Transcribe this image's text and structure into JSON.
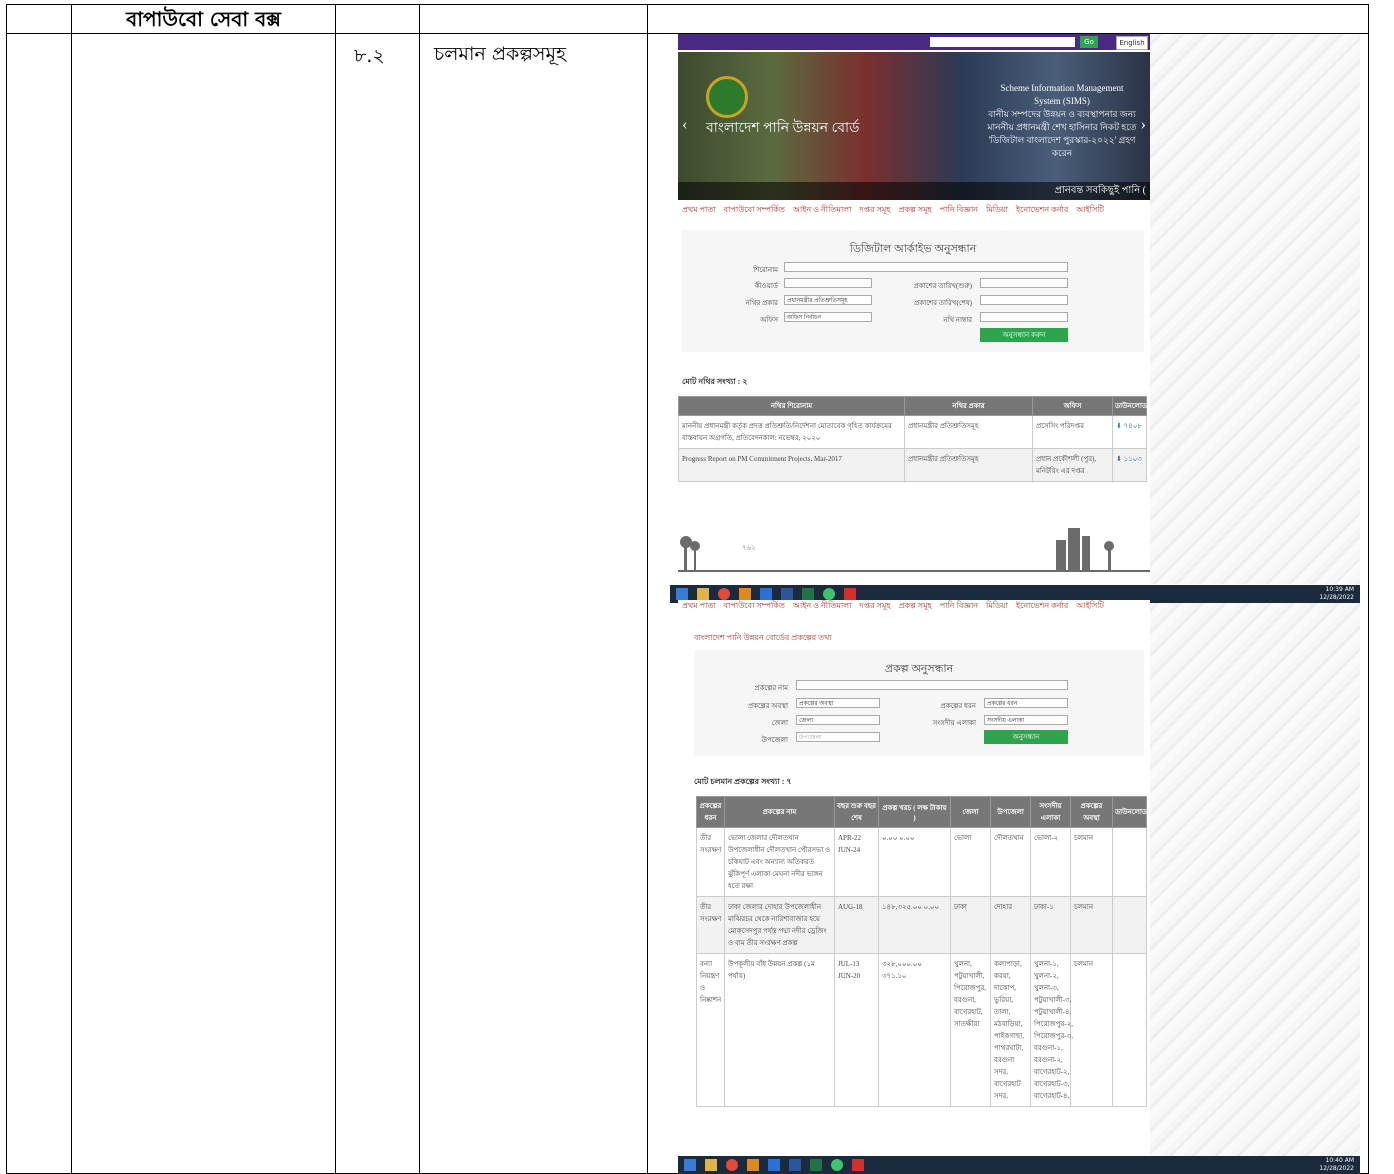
{
  "doc": {
    "heading": "বাপাউবো সেবা বক্স",
    "row_number": "৮.২",
    "row_title": "চলমান প্রকল্পসমূহ"
  },
  "shot1": {
    "search_go": "Go",
    "language": "English",
    "banner_name": "বাংলাদেশ পানি উন্নয়ন বোর্ড",
    "banner_right_lines": [
      "Scheme Information Management",
      "System (SIMS)",
      "বানীয় সম্পদের উন্নয়ন ও ব্যবস্থাপনার জন্য",
      "মাননীয় প্রধানমন্ত্রী শেখ হাসিনার নিকট হতে",
      "'ডিজিটাল বাংলাদেশ পুরস্কার-২০২২' গ্রহণ করেন"
    ],
    "ticker": "প্রানবন্ত সবকিছুই পানি (",
    "nav": [
      "প্রথম পাতা",
      "বাপাউবো সম্পর্কিত",
      "আইন ও নীতিমালা",
      "দপ্তর সমূহ",
      "প্রকল্প সমূহ",
      "পানি বিজ্ঞান",
      "মিডিয়া",
      "ইনোভেশন কর্নার",
      "আইসিটি"
    ],
    "form_title": "ডিজিটাল আর্কাইভ অনুসন্ধান",
    "labels": {
      "title": "শিরোনাম",
      "keyword": "কীওয়ার্ড",
      "doc_type": "নথির প্রকার",
      "office": "অফিস",
      "pub_from": "প্রকাশের তারিখ(শুরু)",
      "pub_to": "প্রকাশের তারিখ(শেষ)",
      "doc_no": "নথি নাম্বার"
    },
    "doc_type_value": "প্রধানমন্ত্রীর প্রতিশ্রুতিসমূহ",
    "office_value": "অফিস নির্বাচন",
    "search_button": "অনুসন্ধান করুন",
    "total": "মোট নথির সংখ্যা : ২",
    "table_headers": [
      "নথির শিরোনাম",
      "নথির প্রকার",
      "অফিস",
      "ডাউনলোড"
    ],
    "rows": [
      {
        "title": "মাননীয় প্রধানমন্ত্রী কর্তৃক প্রদত্ত প্রতিশ্রুতি/নির্দেশনা মোতাবেক গৃহিত কার্যক্রমের বাস্তবায়ন অগ্রগতি, প্রতিবেদনকাল: নভেম্বর, ২০২০",
        "type": "প্রধানমন্ত্রীর প্রতিশ্রুতিসমূহ",
        "office": "প্রসেসিং পরিদপ্তর",
        "download": "৭৪০৮"
      },
      {
        "title": "Progress Report on PM Commitment Projects, Mar-2017",
        "type": "প্রধানমন্ত্রীর প্রতিশ্রুতিসমূহ",
        "office": "প্রধান প্রকৌশলী (পুর), মনিটরিং এর দপ্তর",
        "download": "১১০৩"
      }
    ],
    "footer_mark": "৭৬২"
  },
  "taskbar1": {
    "time": "10:39 AM",
    "date": "12/28/2022"
  },
  "shot2": {
    "nav": [
      "প্রথম পাতা",
      "বাপাউবো সম্পর্কিত",
      "আইন ও নীতিমালা",
      "দপ্তর সমূহ",
      "প্রকল্প সমূহ",
      "পানি বিজ্ঞান",
      "মিডিয়া",
      "ইনোভেশন কর্নার",
      "আইসিটি"
    ],
    "crumb": "বাংলাদেশ পানি উন্নয়ন বোর্ডের প্রকল্পের তথ্য",
    "form_title": "প্রকল্প অনুসন্ধান",
    "labels": {
      "name": "প্রকল্পের নাম",
      "status": "প্রকল্পের অবস্থা",
      "district": "জেলা",
      "upazila": "উপজেলা",
      "kind": "প্রকল্পের ধরন",
      "area": "সংসদীয় এলাকা"
    },
    "values": {
      "status": "প্রকল্পের অবস্থা",
      "district": "জেলা",
      "upazila": "উপজেলা",
      "kind": "প্রকল্পের ধরন",
      "area": "সংসদীয় এলাকা"
    },
    "search_button": "অনুসন্ধান",
    "total": "মোট চলমান প্রকল্পের সংখ্যা : ৭",
    "table_headers": [
      "প্রকল্পের ধরন",
      "প্রকল্পের নাম",
      "বছর শুরু বছর শেষ",
      "প্রকল্প খরচ ( লক্ষ টাকায় )",
      "জেলা",
      "উপজেলা",
      "সংসদীয় এলাকা",
      "প্রকল্পের অবস্থা",
      "ডাউনলোড"
    ],
    "rows": [
      {
        "kind": "তীর সংরক্ষণ",
        "name": "ভোলা জেলার দৌলতখান উপজেলাধীন দৌলতখান পৌরসভা ও চকিঘাট এবং অন্যান্য অতিকরত ঝুঁকিপূর্ণ এলাকা মেঘনা নদীর ভাঙ্গন হতে রক্ষা",
        "years": "APR-22 JUN-24",
        "cost": "০.০০ ০.০০",
        "district": "ভোলা",
        "upazila": "দৌলতখান",
        "area": "ভোলা-২",
        "status": "চলমান"
      },
      {
        "kind": "তীর সংরক্ষণ",
        "name": "ঢাকা জেলার দোহার উপজেলাধীন মাঝিরচর থেকে নারিশাবাজার হয়ে মোকসেদপুর পর্যন্ত পদ্মা নদীর ড্রেজিং ও বাম তীর সংরক্ষণ প্রকল্প",
        "years": "AUG-18",
        "cost": "১৪৮,৩২৫.০০ ০.০০",
        "district": "ঢাকা",
        "upazila": "দোহার",
        "area": "ঢাকা-১",
        "status": "চলমান"
      },
      {
        "kind": "বন্যা নিয়ন্ত্রণ ও নিষ্কাশন",
        "name": "উপকূলীয় বাঁধ উন্নয়ন প্রকল্প (১ম পর্যায়)",
        "years": "JUL-13 JUN-20",
        "cost": "৩২৮,০০০.০০ ৩৭১.১০",
        "district": "খুলনা, পটুয়াখালী, পিরোজপুর, বরগুনা, বাগেরহাট, সাতক্ষীরা",
        "upazila": "কলাপাড়া, করয়া, দাকোপ, ভুরিয়া, তালা, মঠবাড়িয়া, পাইকগাছা, পাথরঘাটা, বরগুনা সদর, বাগেরহাট সদর,",
        "area": "খুলনা-১, খুলনা-২, খুলনা-৩, পটুয়াখালী-৩, পটুয়াখালী-৪, পিরোজপুর-২, পিরোজপুর-৩, বরগুনা-১, বরগুনা-২, বাগেরহাট-২, বাগেরহাট-৩, বাগেরহাট-৪,",
        "status": "চলমান"
      }
    ]
  },
  "taskbar2": {
    "time": "10:40 AM",
    "date": "12/28/2022"
  },
  "colors": {
    "accent_purple": "#4a2b84",
    "button_green": "#2ea44f",
    "nav_red": "#b8332e",
    "taskbar": "#1b2a3d"
  }
}
